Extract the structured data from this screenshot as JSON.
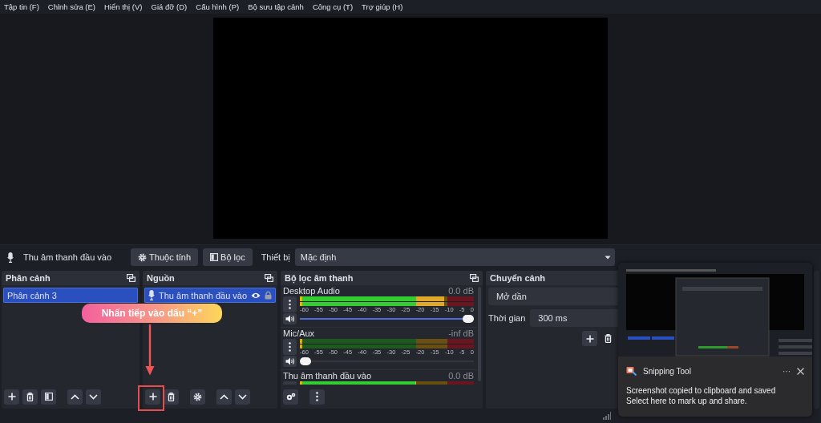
{
  "menu": [
    "Tập tin (F)",
    "Chỉnh sửa (E)",
    "Hiển thị (V)",
    "Giá đỡ (D)",
    "Cấu hình (P)",
    "Bộ sưu tập cảnh",
    "Công cụ (T)",
    "Trợ giúp (H)"
  ],
  "context_bar": {
    "source": "Thu âm thanh đầu vào",
    "properties": "Thuộc tính",
    "filters": "Bộ lọc",
    "device_label": "Thiết bị",
    "device": "Mặc định"
  },
  "scenes": {
    "title": "Phân cảnh",
    "items": [
      {
        "label": "Phân cảnh 3",
        "selected": true
      }
    ]
  },
  "sources": {
    "title": "Nguồn",
    "items": [
      {
        "label": "Thu âm thanh đầu vào",
        "selected": true,
        "visible": true,
        "locked": true
      }
    ]
  },
  "mixer": {
    "title": "Bộ lọc âm thanh",
    "channels": [
      {
        "name": "Desktop Audio",
        "reading": "0.0 dB",
        "meter": {
          "level": 0.83
        },
        "scale": [
          "-60",
          "-55",
          "-50",
          "-45",
          "-40",
          "-35",
          "-30",
          "-25",
          "-20",
          "-15",
          "-10",
          "-5",
          "0"
        ],
        "volume": {
          "level": 1
        }
      },
      {
        "name": "Mic/Aux",
        "reading": "-inf dB",
        "meter": {
          "level": 0
        },
        "scale": [
          "-60",
          "-55",
          "-50",
          "-45",
          "-40",
          "-35",
          "-30",
          "-25",
          "-20",
          "-15",
          "-10",
          "-5",
          "0"
        ],
        "volume": {
          "level": 0
        }
      },
      {
        "name": "Thu âm thanh đầu vào",
        "reading": "0.0 dB",
        "meter": {
          "level": 0.67
        }
      }
    ]
  },
  "transitions": {
    "title": "Chuyển cảnh",
    "transition": "Mở dần",
    "duration_label": "Thời gian",
    "duration": "300 ms"
  },
  "annotation": {
    "text": "Nhấn tiếp vào dấu “+”"
  },
  "notification": {
    "app": "Snipping Tool",
    "more": "···",
    "lines": [
      "Screenshot copied to clipboard and saved",
      "Select here to mark up and share."
    ]
  }
}
